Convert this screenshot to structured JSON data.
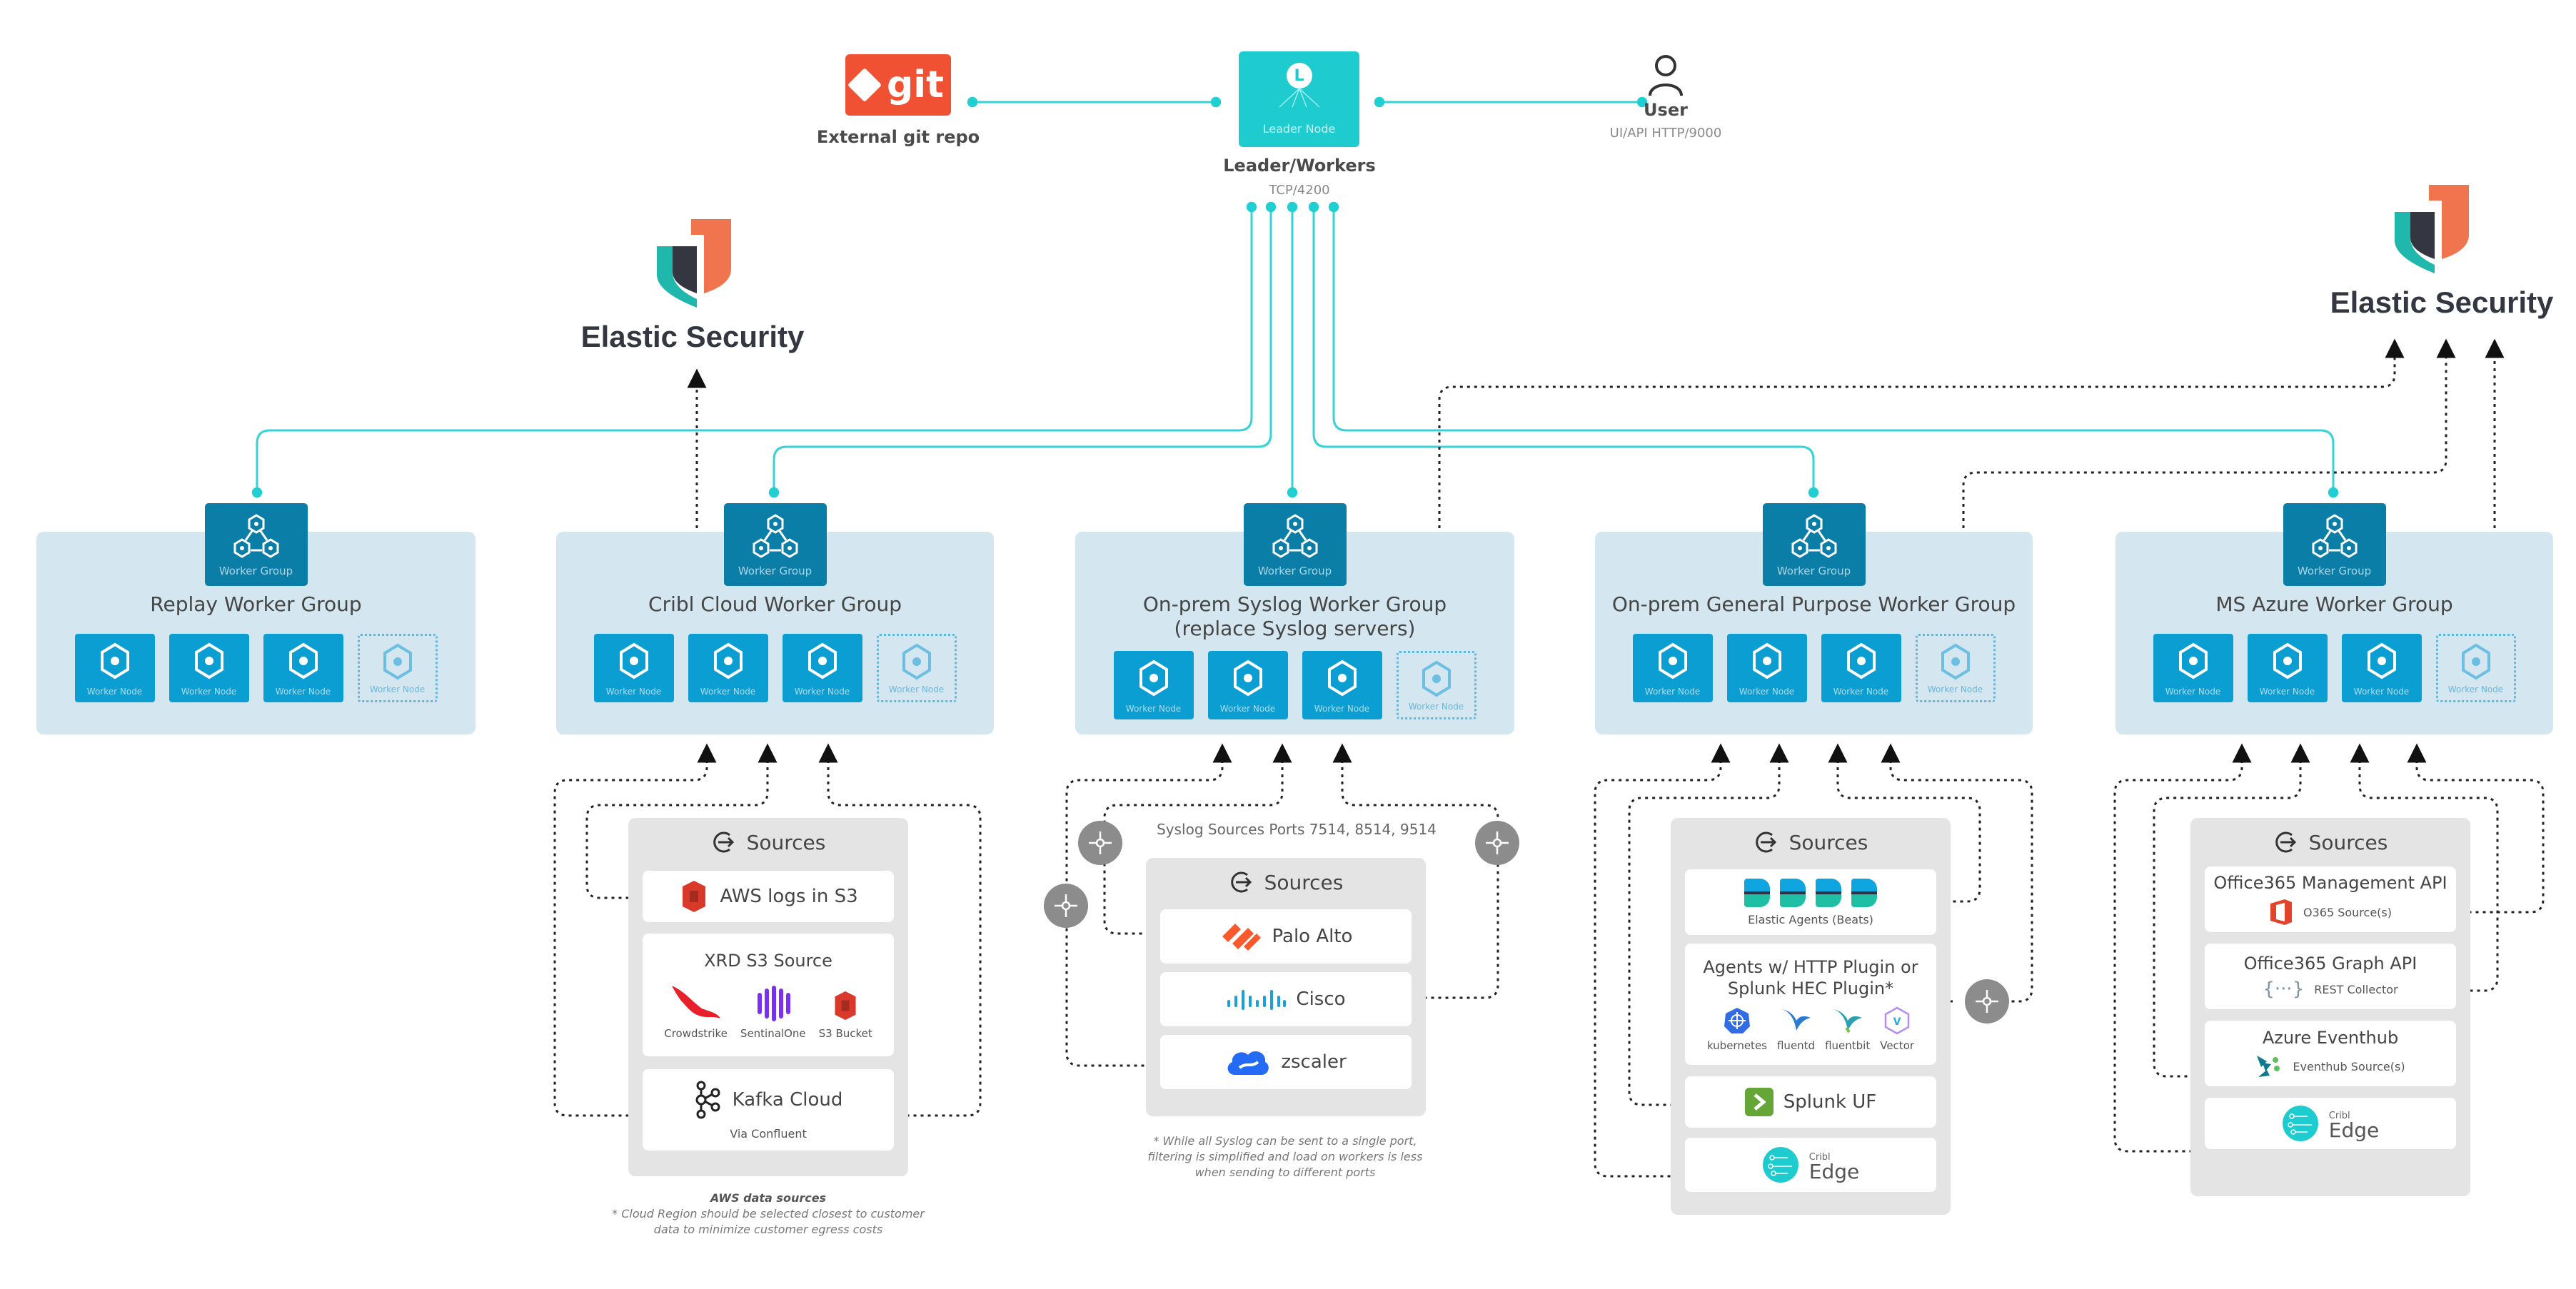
{
  "top": {
    "git": {
      "logo_text": "git",
      "label": "External git repo"
    },
    "leader": {
      "badge": "L",
      "box_text": "Leader Node",
      "label": "Leader/Workers",
      "port": "TCP/4200"
    },
    "user": {
      "label": "User",
      "port": "UI/API HTTP/9000"
    }
  },
  "destinations": [
    {
      "title": "Elastic Security"
    },
    {
      "title": "Elastic Security"
    }
  ],
  "worker_groups": [
    {
      "header": "Worker Group",
      "title": "Replay Worker Group",
      "subtitle": "",
      "nodes": [
        "Worker Node",
        "Worker Node",
        "Worker Node"
      ],
      "ghost_node": "Worker Node"
    },
    {
      "header": "Worker Group",
      "title": "Cribl Cloud Worker Group",
      "subtitle": "",
      "nodes": [
        "Worker Node",
        "Worker Node",
        "Worker Node"
      ],
      "ghost_node": "Worker Node"
    },
    {
      "header": "Worker Group",
      "title": "On-prem Syslog Worker Group",
      "subtitle": "(replace Syslog servers)",
      "nodes": [
        "Worker Node",
        "Worker Node",
        "Worker Node"
      ],
      "ghost_node": "Worker Node"
    },
    {
      "header": "Worker Group",
      "title": "On-prem General Purpose Worker Group",
      "subtitle": "",
      "nodes": [
        "Worker Node",
        "Worker Node",
        "Worker Node"
      ],
      "ghost_node": "Worker Node"
    },
    {
      "header": "Worker Group",
      "title": "MS Azure Worker Group",
      "subtitle": "",
      "nodes": [
        "Worker Node",
        "Worker Node",
        "Worker Node"
      ],
      "ghost_node": "Worker Node"
    }
  ],
  "sources": {
    "heading": "Sources",
    "cloud": {
      "aws": "AWS logs in S3",
      "xrd_title": "XRD S3 Source",
      "xrd_logos": [
        "Crowdstrike",
        "SentinalOne",
        "S3 Bucket"
      ],
      "kafka": "Kafka Cloud",
      "kafka_sub": "Via Confluent",
      "note_title": "AWS data sources",
      "note_lines": [
        "* Cloud Region should be selected closest to customer",
        "data to minimize customer egress costs"
      ]
    },
    "syslog": {
      "ports_label": "Syslog Sources Ports 7514, 8514, 9514",
      "items": [
        "Palo Alto",
        "Cisco",
        "zscaler"
      ],
      "note_lines": [
        "* While all Syslog can be sent to a single port,",
        "filtering is simplified and load on workers is less",
        "when sending to different ports"
      ]
    },
    "general": {
      "beats_label": "Elastic Agents (Beats)",
      "agents_title_1": "Agents w/ HTTP Plugin or",
      "agents_title_2": "Splunk HEC Plugin*",
      "agent_logos": [
        "kubernetes",
        "fluentd",
        "fluentbit",
        "Vector"
      ],
      "splunk": "Splunk UF",
      "edge_small": "Cribl",
      "edge_big": "Edge"
    },
    "azure": {
      "o365_mgmt": "Office365 Management API",
      "o365_mgmt_sub": "O365 Source(s)",
      "o365_graph": "Office365 Graph API",
      "o365_graph_sub": "REST Collector",
      "eventhub": "Azure Eventhub",
      "eventhub_sub": "Eventhub Source(s)",
      "edge_small": "Cribl",
      "edge_big": "Edge"
    }
  },
  "colors": {
    "leader": "#1ecbce",
    "worker_group_header": "#0b7ea8",
    "worker_node": "#0b9ed3",
    "worker_group_bg": "#d4e6ef",
    "sources_bg": "#e4e4e4",
    "git": "#f05133",
    "connector_cyan": "#35d3d6",
    "elastic_orange": "#f0744d",
    "elastic_teal": "#20b8ac",
    "elastic_dark": "#343741"
  }
}
